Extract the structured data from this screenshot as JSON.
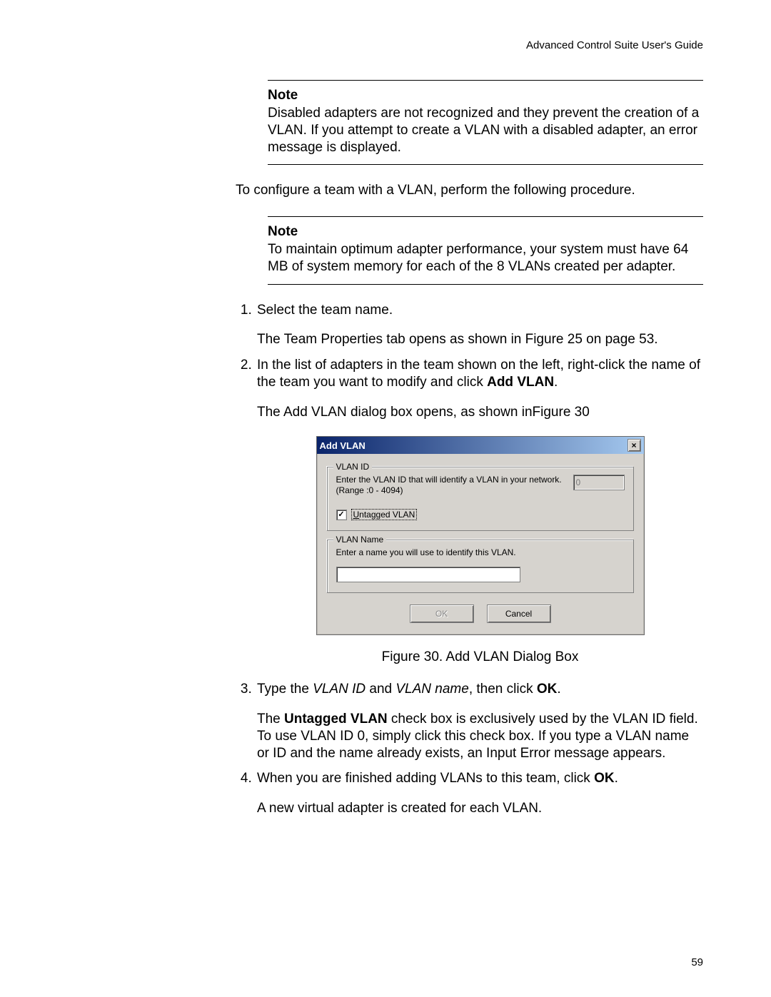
{
  "header": {
    "running_title": "Advanced Control Suite User's Guide"
  },
  "page_number": "59",
  "note1": {
    "heading": "Note",
    "body": "Disabled adapters are not recognized and they prevent the creation of a VLAN. If you attempt to create a VLAN with a disabled adapter, an error message is displayed."
  },
  "intro": "To configure a team with a VLAN, perform the following procedure.",
  "note2": {
    "heading": "Note",
    "body": "To maintain optimum adapter performance, your system must have 64 MB of system memory for each of the 8 VLANs created per adapter."
  },
  "steps": {
    "s1": {
      "text": "Select the team name.",
      "sub": "The Team Properties tab opens as shown in Figure 25 on page 53."
    },
    "s2": {
      "lead": "In the list of adapters in the team shown on the left, right-click the name of the team you want to modify and click ",
      "bold": "Add VLAN",
      "tail": ".",
      "sub": "The Add VLAN dialog box opens, as shown inFigure 30"
    },
    "s3": {
      "lead": "Type the ",
      "i1": "VLAN ID",
      "mid": " and ",
      "i2": "VLAN name",
      "mid2": ", then click ",
      "bold": "OK",
      "tail": ".",
      "sub_lead": "The ",
      "sub_bold": "Untagged VLAN",
      "sub_tail": " check box is exclusively used by the VLAN ID field. To use VLAN ID 0, simply click this check box. If you type a VLAN name or ID and the name already exists, an Input Error message appears."
    },
    "s4": {
      "lead": "When you are finished adding VLANs to this team, click ",
      "bold": "OK",
      "tail": ".",
      "sub": "A new virtual adapter is created for each VLAN."
    }
  },
  "figure_caption": "Figure 30. Add VLAN Dialog Box",
  "dialog": {
    "title": "Add VLAN",
    "vlan_id": {
      "group_title": "VLAN ID",
      "instruction": "Enter the VLAN ID that will identify a VLAN in your network. (Range :0 - 4094)",
      "value": "0"
    },
    "checkbox": {
      "label_pre": "U",
      "label_rest": "ntagged VLAN"
    },
    "vlan_name": {
      "group_title": "VLAN Name",
      "instruction": "Enter a name you will use to identify this VLAN.",
      "value": ""
    },
    "ok": "OK",
    "cancel": "Cancel",
    "close_glyph": "×"
  }
}
